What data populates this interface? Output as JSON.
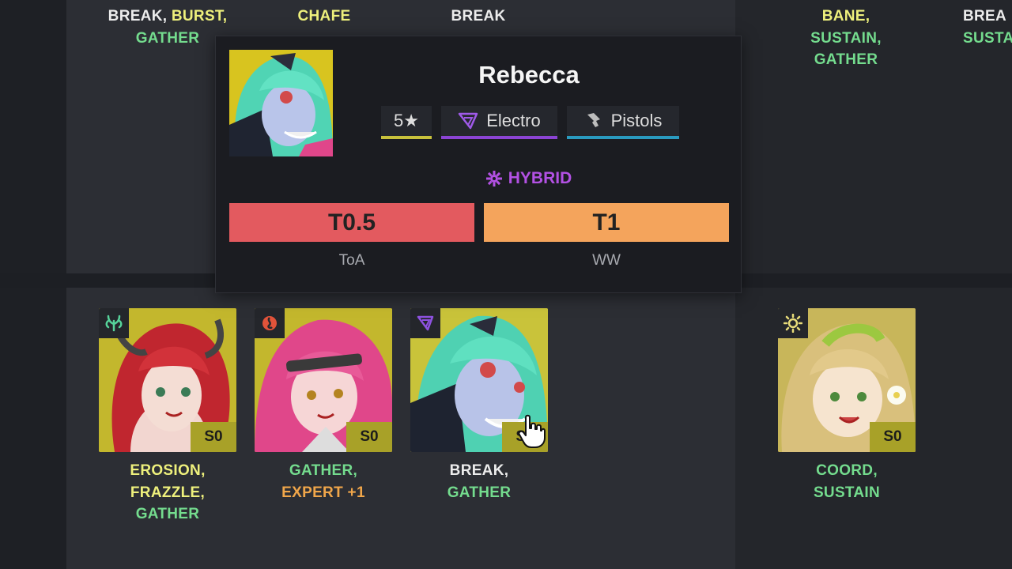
{
  "top_row": {
    "col1_tags": [
      {
        "text": "BREAK, ",
        "color": "white"
      },
      {
        "text": "BURST,",
        "color": "yellow"
      },
      {
        "text": "GATHER",
        "color": "green"
      }
    ],
    "col2_tags": [
      {
        "text": "CHAFE",
        "color": "yellow"
      }
    ],
    "col3_tags": [
      {
        "text": "BREAK",
        "color": "white"
      }
    ],
    "col4_tags": [
      {
        "text": "BANE,",
        "color": "yellow"
      },
      {
        "text": "SUSTAIN,",
        "color": "green"
      },
      {
        "text": "GATHER",
        "color": "green"
      }
    ],
    "col5_tags": [
      {
        "text": "BREA",
        "color": "white"
      },
      {
        "text": "SUSTA",
        "color": "green"
      }
    ]
  },
  "popup": {
    "name": "Rebecca",
    "rarity": "5★",
    "element": "Electro",
    "weapon": "Pistols",
    "archetype": "HYBRID",
    "tiers": [
      {
        "value": "T0.5",
        "label": "ToA",
        "color": "#e35a5f"
      },
      {
        "value": "T1",
        "label": "WW",
        "color": "#f4a45c"
      }
    ],
    "colors": {
      "rarity_bar": "#c9c23c",
      "element_bar": "#8b44d4",
      "weapon_bar": "#2a9bc0",
      "archetype": "#b351e4"
    }
  },
  "cards": [
    {
      "name": "erosion character",
      "element_icon": "bloom-icon",
      "rank": "S0",
      "tags_line1": "EROSION,",
      "tags_line2": "FRAZZLE,",
      "tags_line3": "GATHER"
    },
    {
      "name": "pink character",
      "element_icon": "fire-icon",
      "rank": "S0",
      "tags_line1": "GATHER,",
      "tags_line2": "EXPERT +1"
    },
    {
      "name": "Rebecca",
      "element_icon": "electro-icon",
      "rank": "S0",
      "tags_line1": "BREAK,",
      "tags_line2": "GATHER"
    },
    {
      "name": "blonde character",
      "element_icon": "light-icon",
      "rank": "S0",
      "tags_line1": "COORD,",
      "tags_line2": "SUSTAIN"
    }
  ]
}
